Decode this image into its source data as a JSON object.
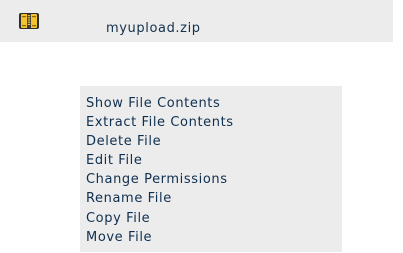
{
  "file": {
    "icon": "zip-archive-icon",
    "name": "myupload.zip"
  },
  "actions": [
    {
      "label": "Show File Contents"
    },
    {
      "label": "Extract File Contents"
    },
    {
      "label": "Delete File"
    },
    {
      "label": "Edit File"
    },
    {
      "label": "Change Permissions"
    },
    {
      "label": "Rename File"
    },
    {
      "label": "Copy File"
    },
    {
      "label": "Move File"
    }
  ],
  "colors": {
    "panel_bg": "#ececec",
    "text": "#14314d",
    "icon_yellow": "#f2c230",
    "icon_dark": "#2d2d2d"
  }
}
